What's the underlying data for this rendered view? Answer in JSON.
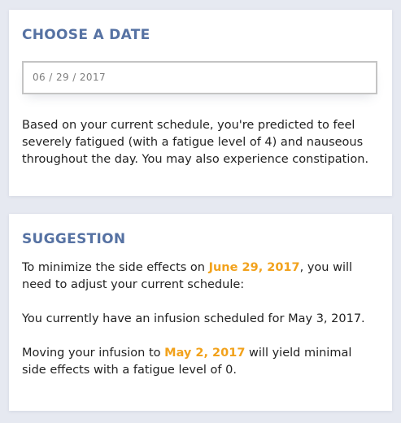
{
  "colors": {
    "background": "#e6e9f1",
    "card": "#ffffff",
    "title": "#5672a3",
    "highlight": "#f2a21c",
    "text": "#222222"
  },
  "choose_date": {
    "title": "CHOOSE A DATE",
    "date_value": "06 / 29 / 2017",
    "prediction": "Based on your current schedule, you're predicted to feel severely fatigued (with a fatigue level of 4) and nauseous throughout the day. You may also experience constipation."
  },
  "suggestion": {
    "title": "SUGGESTION",
    "intro_before": "To minimize the side effects on ",
    "intro_date": "June 29, 2017",
    "intro_after": ", you will need to adjust your current schedule:",
    "current": "You currently have an infusion scheduled for May 3, 2017.",
    "moving_before": "Moving your infusion to ",
    "moving_date": "May 2, 2017",
    "moving_after": " will yield minimal side effects with a fatigue level of 0."
  }
}
